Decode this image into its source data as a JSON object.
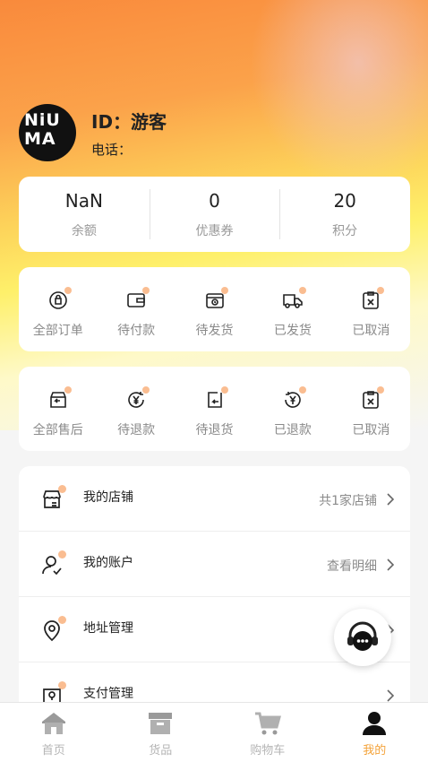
{
  "profile": {
    "avatar_text": "NiUMA",
    "id_label": "ID：游客",
    "phone_label": "电话："
  },
  "stats": [
    {
      "value": "NaN",
      "label": "余额"
    },
    {
      "value": "0",
      "label": "优惠券"
    },
    {
      "value": "20",
      "label": "积分"
    }
  ],
  "orders": [
    {
      "label": "全部订单",
      "icon": "all-orders-icon"
    },
    {
      "label": "待付款",
      "icon": "wallet-icon"
    },
    {
      "label": "待发货",
      "icon": "box-clock-icon"
    },
    {
      "label": "已发货",
      "icon": "truck-icon"
    },
    {
      "label": "已取消",
      "icon": "cancel-doc-icon"
    }
  ],
  "aftersale": [
    {
      "label": "全部售后",
      "icon": "return-box-icon"
    },
    {
      "label": "待退款",
      "icon": "refund-yen-icon"
    },
    {
      "label": "待退货",
      "icon": "return-doc-icon"
    },
    {
      "label": "已退款",
      "icon": "refunded-icon"
    },
    {
      "label": "已取消",
      "icon": "cancel-doc-icon"
    }
  ],
  "menu": [
    {
      "label": "我的店铺",
      "value": "共1家店铺",
      "icon": "store-icon"
    },
    {
      "label": "我的账户",
      "value": "查看明细",
      "icon": "user-check-icon"
    },
    {
      "label": "地址管理",
      "value": "",
      "icon": "location-pin-icon"
    },
    {
      "label": "支付管理",
      "value": "",
      "icon": "payment-icon"
    }
  ],
  "floating": {
    "icon": "customer-service-icon"
  },
  "tabbar": [
    {
      "label": "首页",
      "icon": "home-icon"
    },
    {
      "label": "货品",
      "icon": "goods-box-icon"
    },
    {
      "label": "购物车",
      "icon": "cart-icon"
    },
    {
      "label": "我的",
      "icon": "user-icon",
      "active": true
    }
  ],
  "colors": {
    "accent": "#f4a33a",
    "dot": "#f9b27e",
    "header_top": "#f98a3c",
    "header_mid": "#fef06a"
  }
}
